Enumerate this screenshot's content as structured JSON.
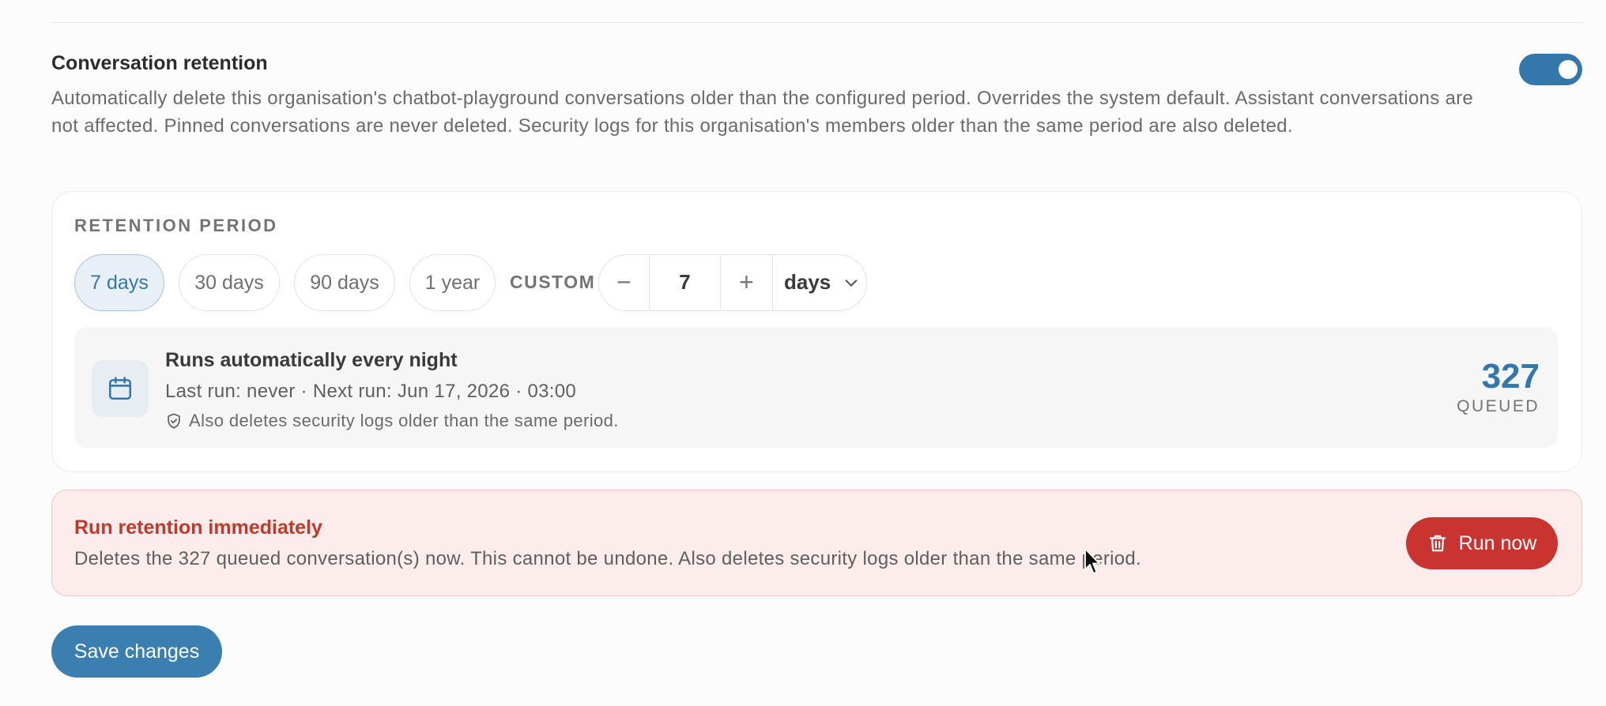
{
  "section": {
    "title": "Conversation retention",
    "description": "Automatically delete this organisation's chatbot-playground conversations older than the configured period. Overrides the system default. Assistant conversations are not affected. Pinned conversations are never deleted. Security logs for this organisation's members older than the same period are also deleted.",
    "enabled": true
  },
  "retention": {
    "label": "RETENTION PERIOD",
    "presets": [
      {
        "label": "7 days",
        "active": true
      },
      {
        "label": "30 days",
        "active": false
      },
      {
        "label": "90 days",
        "active": false
      },
      {
        "label": "1 year",
        "active": false
      }
    ],
    "custom_label": "CUSTOM",
    "custom_value": "7",
    "minus_symbol": "−",
    "plus_symbol": "+",
    "unit": "days"
  },
  "schedule": {
    "title": "Runs automatically every night",
    "meta": "Last run: never · Next run: Jun 17, 2026 · 03:00",
    "note": "Also deletes security logs older than the same period.",
    "queued_count": "327",
    "queued_label": "QUEUED",
    "icon": "calendar-icon"
  },
  "danger": {
    "title": "Run retention immediately",
    "description": "Deletes the 327 queued conversation(s) now. This cannot be undone. Also deletes security logs older than the same period.",
    "button_label": "Run now"
  },
  "actions": {
    "save_label": "Save changes"
  },
  "colors": {
    "accent": "#3478ab",
    "danger": "#c93330",
    "danger_bg": "#fcecec"
  }
}
